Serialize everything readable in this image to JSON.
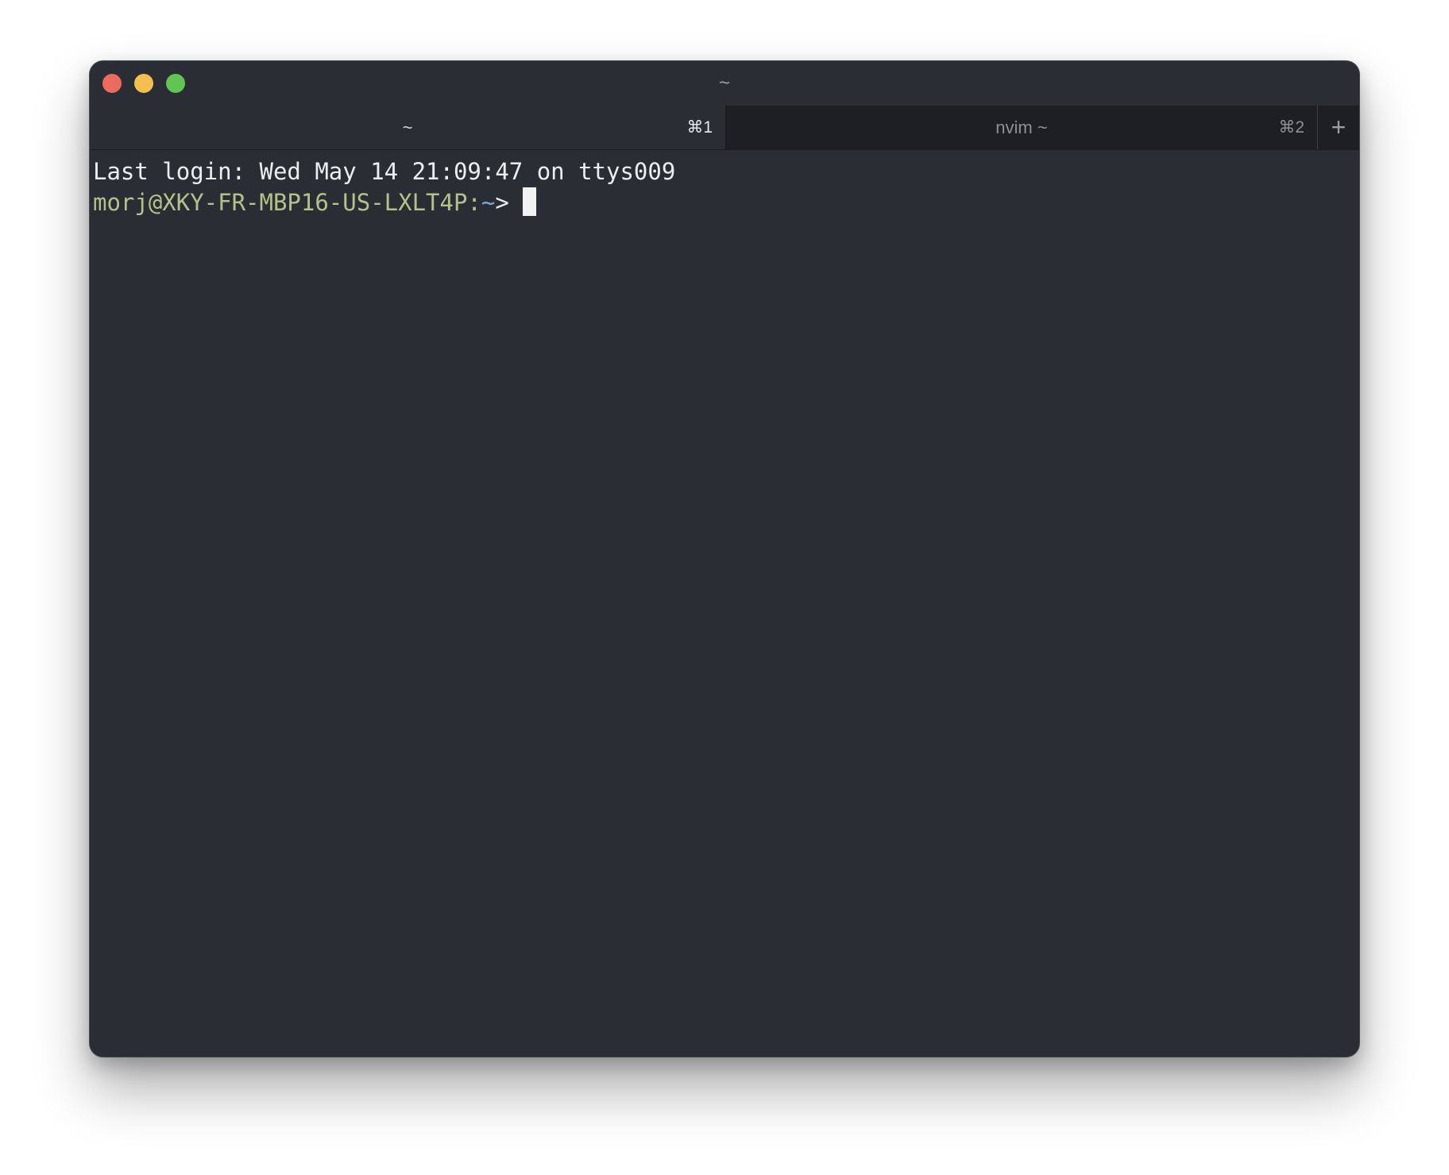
{
  "window": {
    "title": "~",
    "controls": {
      "close": {
        "icon": "close-traffic-light",
        "color": "#ed6a5e"
      },
      "minimize": {
        "icon": "minimize-traffic-light",
        "color": "#f5bf4f"
      },
      "zoom": {
        "icon": "zoom-traffic-light",
        "color": "#61c554"
      }
    }
  },
  "tabs": [
    {
      "title": "~",
      "shortcut": "⌘1",
      "active": true
    },
    {
      "title": "nvim ~",
      "shortcut": "⌘2",
      "active": false
    }
  ],
  "new_tab": {
    "label": "+",
    "icon": "plus-icon"
  },
  "terminal": {
    "login_line": "Last login: Wed May 14 21:09:47 on ttys009",
    "prompt": {
      "user_host": "morj@XKY-FR-MBP16-US-LXLT4P:",
      "path": "~",
      "symbol": ">"
    }
  }
}
